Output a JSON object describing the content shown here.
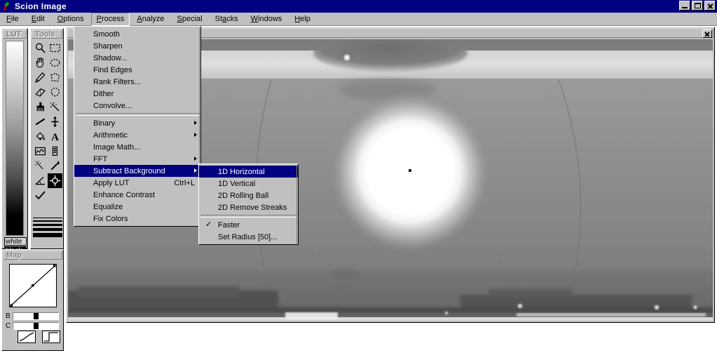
{
  "window": {
    "title": "Scion Image",
    "icon": "leaf-icon",
    "controls": [
      {
        "name": "minimize-button",
        "label": "Minimize"
      },
      {
        "name": "maximize-button",
        "label": "Maximize"
      },
      {
        "name": "close-button",
        "label": "Close"
      }
    ]
  },
  "menubar": {
    "items": [
      {
        "label": "File",
        "mnemonic": "F",
        "open": false
      },
      {
        "label": "Edit",
        "mnemonic": "E",
        "open": false
      },
      {
        "label": "Options",
        "mnemonic": "O",
        "open": false
      },
      {
        "label": "Process",
        "mnemonic": "P",
        "open": true
      },
      {
        "label": "Analyze",
        "mnemonic": "A",
        "open": false
      },
      {
        "label": "Special",
        "mnemonic": "S",
        "open": false
      },
      {
        "label": "Stacks",
        "mnemonic": "S",
        "open": false
      },
      {
        "label": "Windows",
        "mnemonic": "W",
        "open": false
      },
      {
        "label": "Help",
        "mnemonic": "H",
        "open": false
      }
    ]
  },
  "process_menu": {
    "items": [
      {
        "label": "Smooth",
        "shortcut": "",
        "submenu": false,
        "checked": false,
        "highlighted": false
      },
      {
        "label": "Sharpen",
        "shortcut": "",
        "submenu": false,
        "checked": false,
        "highlighted": false
      },
      {
        "label": "Shadow...",
        "shortcut": "",
        "submenu": false,
        "checked": false,
        "highlighted": false
      },
      {
        "label": "Find Edges",
        "shortcut": "",
        "submenu": false,
        "checked": false,
        "highlighted": false
      },
      {
        "label": "Rank Filters...",
        "shortcut": "",
        "submenu": false,
        "checked": false,
        "highlighted": false
      },
      {
        "label": "Dither",
        "shortcut": "",
        "submenu": false,
        "checked": false,
        "highlighted": false
      },
      {
        "label": "Convolve...",
        "shortcut": "",
        "submenu": false,
        "checked": false,
        "highlighted": false
      },
      {
        "separator": true
      },
      {
        "label": "Binary",
        "shortcut": "",
        "submenu": true,
        "checked": false,
        "highlighted": false
      },
      {
        "label": "Arithmetic",
        "shortcut": "",
        "submenu": true,
        "checked": false,
        "highlighted": false
      },
      {
        "label": "Image Math...",
        "shortcut": "",
        "submenu": false,
        "checked": false,
        "highlighted": false
      },
      {
        "label": "FFT",
        "shortcut": "",
        "submenu": true,
        "checked": false,
        "highlighted": false
      },
      {
        "label": "Subtract Background",
        "shortcut": "",
        "submenu": true,
        "checked": false,
        "highlighted": true
      },
      {
        "label": "Apply LUT",
        "shortcut": "Ctrl+L",
        "submenu": false,
        "checked": false,
        "highlighted": false
      },
      {
        "label": "Enhance Contrast",
        "shortcut": "",
        "submenu": false,
        "checked": false,
        "highlighted": false
      },
      {
        "label": "Equalize",
        "shortcut": "",
        "submenu": false,
        "checked": false,
        "highlighted": false
      },
      {
        "label": "Fix Colors",
        "shortcut": "",
        "submenu": false,
        "checked": false,
        "highlighted": false
      }
    ]
  },
  "subtract_background_submenu": {
    "items": [
      {
        "label": "1D Horizontal",
        "checked": false,
        "highlighted": true
      },
      {
        "label": "1D Vertical",
        "checked": false,
        "highlighted": false
      },
      {
        "label": "2D Rolling Ball",
        "checked": false,
        "highlighted": false
      },
      {
        "label": "2D Remove Streaks",
        "checked": false,
        "highlighted": false
      },
      {
        "separator": true
      },
      {
        "label": "Faster",
        "checked": true,
        "highlighted": false
      },
      {
        "label": "Set Radius [50]...",
        "checked": false,
        "highlighted": false
      }
    ]
  },
  "lut_palette": {
    "title": "LUT",
    "top_label": "white",
    "bottom_label": "black"
  },
  "tools_palette": {
    "title": "Tools",
    "tools": [
      {
        "name": "magnifier-tool",
        "selected": false
      },
      {
        "name": "rectangle-select-tool",
        "selected": false
      },
      {
        "name": "hand-tool",
        "selected": false
      },
      {
        "name": "oval-select-tool",
        "selected": false
      },
      {
        "name": "pencil-tool",
        "selected": false
      },
      {
        "name": "polygon-select-tool",
        "selected": false
      },
      {
        "name": "eraser-tool",
        "selected": false
      },
      {
        "name": "freehand-select-tool",
        "selected": false
      },
      {
        "name": "brush-tool",
        "selected": false
      },
      {
        "name": "wand-tool",
        "selected": false
      },
      {
        "name": "line-tool",
        "selected": false
      },
      {
        "name": "move-tool",
        "selected": false
      },
      {
        "name": "paint-bucket-tool",
        "selected": false
      },
      {
        "name": "text-tool",
        "selected": false
      },
      {
        "name": "plot-profile-tool",
        "selected": false
      },
      {
        "name": "density-slice-tool",
        "selected": false
      },
      {
        "name": "sparkle-tool",
        "selected": false
      },
      {
        "name": "eyedropper-tool",
        "selected": false
      },
      {
        "name": "angle-tool",
        "selected": false
      },
      {
        "name": "crosshair-tool",
        "selected": true
      },
      {
        "name": "checkmark-tool",
        "selected": false
      }
    ],
    "line_widths": [
      1,
      2,
      3,
      4,
      6
    ]
  },
  "map_palette": {
    "title": "Map",
    "brightness_label": "B",
    "contrast_label": "C",
    "brightness_value": 50,
    "contrast_value": 50,
    "buttons": [
      {
        "name": "linear-ramp-button"
      },
      {
        "name": "step-ramp-button"
      }
    ]
  },
  "image_window": {
    "title": "",
    "close_label": "Close",
    "content_description": "grayscale-image"
  },
  "colors": {
    "titlebar": "#000080",
    "face": "#c0c0c0",
    "highlight": "#000080",
    "highlight_text": "#ffffff",
    "text": "#000000"
  }
}
